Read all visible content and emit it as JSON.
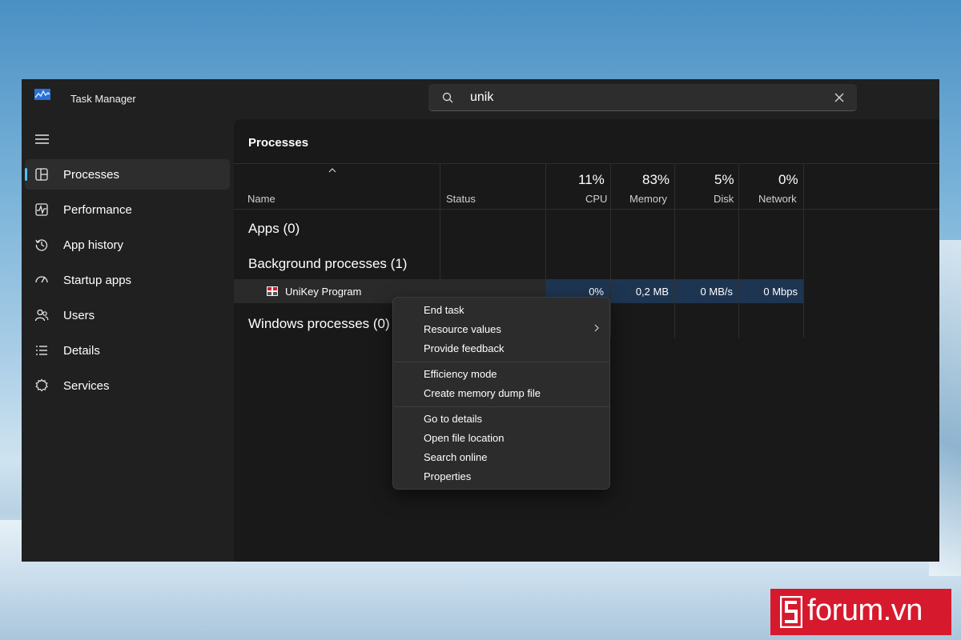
{
  "window": {
    "title": "Task Manager"
  },
  "search": {
    "value": "unik"
  },
  "sidebar": {
    "items": [
      {
        "label": "Processes",
        "icon": "processes-icon",
        "active": true
      },
      {
        "label": "Performance",
        "icon": "performance-icon"
      },
      {
        "label": "App history",
        "icon": "history-icon"
      },
      {
        "label": "Startup apps",
        "icon": "startup-icon"
      },
      {
        "label": "Users",
        "icon": "users-icon"
      },
      {
        "label": "Details",
        "icon": "details-icon"
      },
      {
        "label": "Services",
        "icon": "services-icon"
      }
    ]
  },
  "main": {
    "title": "Processes",
    "columns": {
      "name": "Name",
      "status": "Status",
      "cpu": {
        "percent": "11%",
        "label": "CPU"
      },
      "memory": {
        "percent": "83%",
        "label": "Memory"
      },
      "disk": {
        "percent": "5%",
        "label": "Disk"
      },
      "network": {
        "percent": "0%",
        "label": "Network"
      }
    },
    "groups": {
      "apps": "Apps (0)",
      "background": "Background processes (1)",
      "windows": "Windows processes (0)"
    },
    "process": {
      "name": "UniKey Program",
      "cpu": "0%",
      "memory": "0,2 MB",
      "disk": "0 MB/s",
      "network": "0 Mbps"
    }
  },
  "context_menu": {
    "items": [
      "End task",
      "Resource values",
      "Provide feedback",
      "Efficiency mode",
      "Create memory dump file",
      "Go to details",
      "Open file location",
      "Search online",
      "Properties"
    ]
  },
  "watermark": {
    "text": "forum.vn"
  },
  "colors": {
    "accent": "#4cc2ff",
    "window_bg": "#202020",
    "content_bg": "#191919",
    "highlight_cell": "#1e3552",
    "watermark_red": "#d7192e"
  }
}
